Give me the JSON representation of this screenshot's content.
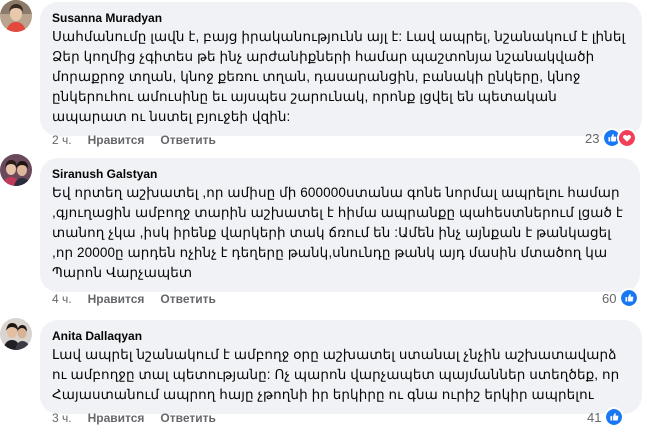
{
  "comments": [
    {
      "author": "Susanna Muradyan",
      "text": "Սահմանումը լավն է, բայց իրականությունն այլ է: Լավ ապրել, նշանակում է լինել Ձեր կողմից չգիտես թե ինչ արժանիքների համար պաշտոնյա նշանակվածի մորաքրոջ տղան, կնոջ քեռու տղան, դասարանցին, բանակի ընկերը, կնոջ ընկերուհու ամուսինը եւ այսպես շարունակ, որոնք լցվել են պետական ապարատ ու նստել բյուջեի վզին:",
      "time": "2 ч.",
      "like": "Нравится",
      "reply": "Ответить",
      "reactions": "23",
      "reaction_icons": [
        "like-icon",
        "love-icon"
      ]
    },
    {
      "author": "Siranush Galstyan",
      "text": "Եվ որտեղ աշխատել ,որ ամիսը մի 600000ստանա գոնե նորմալ ապրելու համար ,գյուղացին ամբողջ տարին աշխատել է հիմա ապրանքը պահեստներում լցած է տանող չկա ,իսկ իրենք վարկերի տակ ճռում են :Ամեն ինչ այնքան է թանկացել ,որ 20000ը արդեն ոչինչ է դեղերը թանկ,սնունդը թանկ այդ մասին մտածող կա Պարոն Վարչապետ",
      "time": "4 ч.",
      "like": "Нравится",
      "reply": "Ответить",
      "reactions": "60",
      "reaction_icons": [
        "like-icon"
      ]
    },
    {
      "author": "Anita Dallaqyan",
      "text": "Լավ ապրել նշանակում է ամբողջ օրը աշխատել ստանալ չնչին աշխատավարձ ու ամբողջը տալ պետությանը: Ոչ պարոն վարչապետ պայմաններ ստեղծեք, որ Հայաստանում ապրող հայը չթողնի իր երկիրը ու գնա ուրիշ երկիր ապրելու",
      "time": "3 ч.",
      "like": "Нравится",
      "reply": "Ответить",
      "reactions": "41",
      "reaction_icons": [
        "like-icon"
      ]
    }
  ],
  "colors": {
    "bubble": "#f0f2f5",
    "meta": "#65676b",
    "like_blue": "#1877f2",
    "love_red": "#f33e58"
  }
}
